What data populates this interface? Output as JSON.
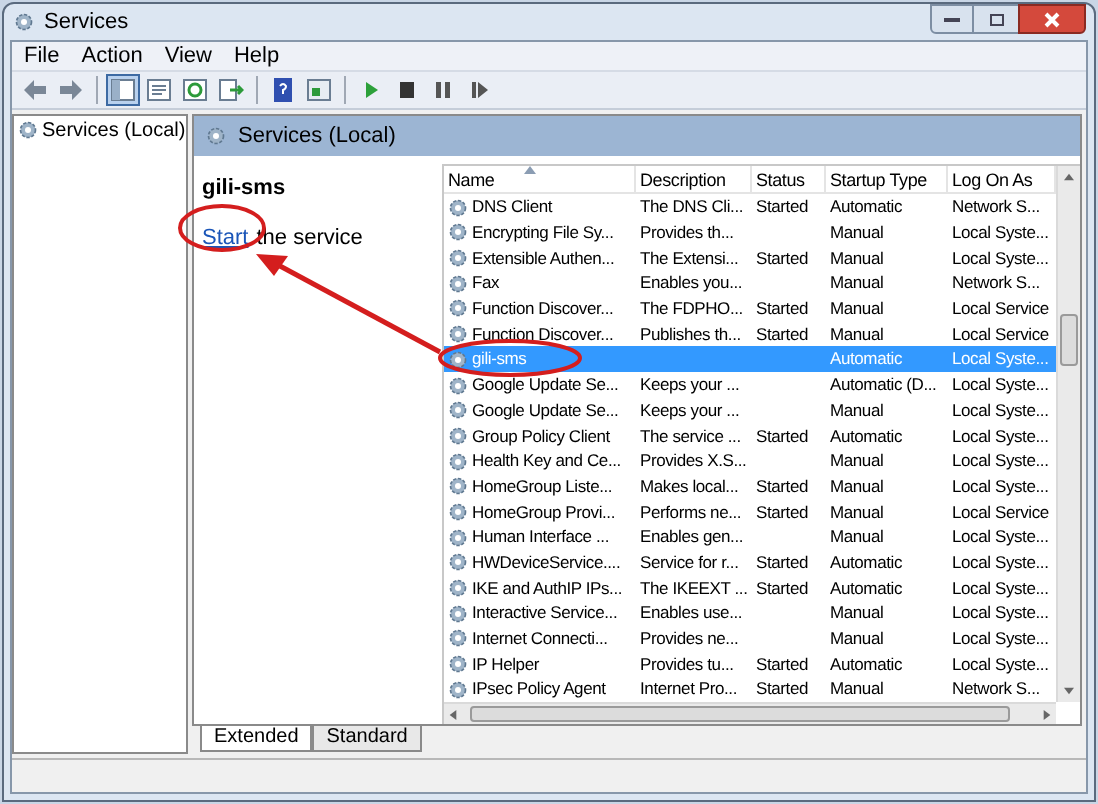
{
  "window": {
    "title": "Services"
  },
  "menu": [
    "File",
    "Action",
    "View",
    "Help"
  ],
  "toolbar": [
    [
      {
        "kind": "back",
        "on": false
      },
      {
        "kind": "forward",
        "on": false
      }
    ],
    [
      {
        "kind": "tree",
        "on": true
      },
      {
        "kind": "properties",
        "on": false
      },
      {
        "kind": "refresh",
        "on": false
      },
      {
        "kind": "export",
        "on": false
      }
    ],
    [
      {
        "kind": "help",
        "on": false
      },
      {
        "kind": "console",
        "on": false
      }
    ],
    [
      {
        "kind": "play",
        "on": false
      },
      {
        "kind": "stop",
        "on": false
      },
      {
        "kind": "pause",
        "on": false
      },
      {
        "kind": "resume",
        "on": false
      }
    ]
  ],
  "tree": {
    "label": "Services (Local)"
  },
  "panel": {
    "title": "Services (Local)"
  },
  "detail": {
    "service_name": "gili-sms",
    "action_link": "Start",
    "action_text": "the service"
  },
  "table": {
    "columns": [
      "Name",
      "Description",
      "Status",
      "Startup Type",
      "Log On As"
    ],
    "rows": [
      {
        "cells": [
          "DNS Client",
          "The DNS Cli...",
          "Started",
          "Automatic",
          "Network S..."
        ],
        "selected": false
      },
      {
        "cells": [
          "Encrypting File Sy...",
          "Provides th...",
          "",
          "Manual",
          "Local Syste..."
        ],
        "selected": false
      },
      {
        "cells": [
          "Extensible Authen...",
          "The Extensi...",
          "Started",
          "Manual",
          "Local Syste..."
        ],
        "selected": false
      },
      {
        "cells": [
          "Fax",
          "Enables you...",
          "",
          "Manual",
          "Network S..."
        ],
        "selected": false
      },
      {
        "cells": [
          "Function Discover...",
          "The FDPHO...",
          "Started",
          "Manual",
          "Local Service"
        ],
        "selected": false
      },
      {
        "cells": [
          "Function Discover...",
          "Publishes th...",
          "Started",
          "Manual",
          "Local Service"
        ],
        "selected": false
      },
      {
        "cells": [
          "gili-sms",
          "",
          "",
          "Automatic",
          "Local Syste..."
        ],
        "selected": true
      },
      {
        "cells": [
          "Google Update Se...",
          "Keeps your ...",
          "",
          "Automatic (D...",
          "Local Syste..."
        ],
        "selected": false
      },
      {
        "cells": [
          "Google Update Se...",
          "Keeps your ...",
          "",
          "Manual",
          "Local Syste..."
        ],
        "selected": false
      },
      {
        "cells": [
          "Group Policy Client",
          "The service ...",
          "Started",
          "Automatic",
          "Local Syste..."
        ],
        "selected": false
      },
      {
        "cells": [
          "Health Key and Ce...",
          "Provides X.S...",
          "",
          "Manual",
          "Local Syste..."
        ],
        "selected": false
      },
      {
        "cells": [
          "HomeGroup Liste...",
          "Makes local...",
          "Started",
          "Manual",
          "Local Syste..."
        ],
        "selected": false
      },
      {
        "cells": [
          "HomeGroup Provi...",
          "Performs ne...",
          "Started",
          "Manual",
          "Local Service"
        ],
        "selected": false
      },
      {
        "cells": [
          "Human Interface ...",
          "Enables gen...",
          "",
          "Manual",
          "Local Syste..."
        ],
        "selected": false
      },
      {
        "cells": [
          "HWDeviceService....",
          "Service for r...",
          "Started",
          "Automatic",
          "Local Syste..."
        ],
        "selected": false
      },
      {
        "cells": [
          "IKE and AuthIP IPs...",
          "The IKEEXT ...",
          "Started",
          "Automatic",
          "Local Syste..."
        ],
        "selected": false
      },
      {
        "cells": [
          "Interactive Service...",
          "Enables use...",
          "",
          "Manual",
          "Local Syste..."
        ],
        "selected": false
      },
      {
        "cells": [
          "Internet Connecti...",
          "Provides ne...",
          "",
          "Manual",
          "Local Syste..."
        ],
        "selected": false
      },
      {
        "cells": [
          "IP Helper",
          "Provides tu...",
          "Started",
          "Automatic",
          "Local Syste..."
        ],
        "selected": false
      },
      {
        "cells": [
          "IPsec Policy Agent",
          "Internet Pro...",
          "Started",
          "Manual",
          "Network S..."
        ],
        "selected": false
      }
    ]
  },
  "tabs": [
    {
      "label": "Extended",
      "selected": true
    },
    {
      "label": "Standard",
      "selected": false
    }
  ]
}
